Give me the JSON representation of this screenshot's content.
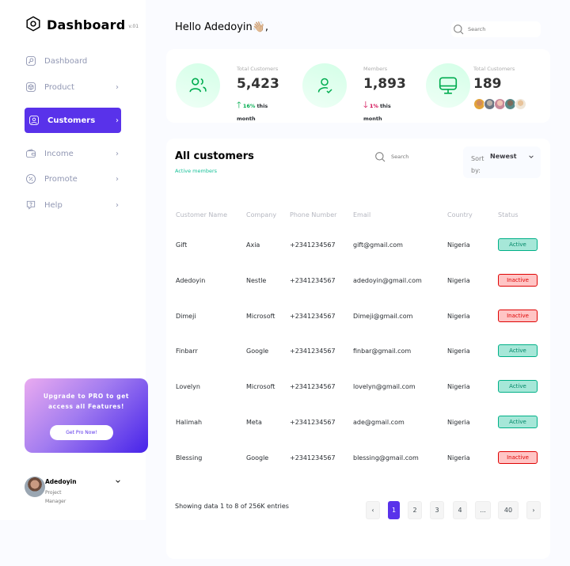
{
  "app": {
    "title": "Dashboard",
    "version": "v.01"
  },
  "sidebar": {
    "items": [
      {
        "label": "Dashboard",
        "icon": "key-square-icon",
        "has_chevron": false
      },
      {
        "label": "Product",
        "icon": "cube-icon",
        "has_chevron": true
      },
      {
        "label": "Customers",
        "icon": "user-square-icon",
        "has_chevron": true,
        "active": true
      },
      {
        "label": "Income",
        "icon": "wallet-money-icon",
        "has_chevron": true
      },
      {
        "label": "Promote",
        "icon": "discount-shape-icon",
        "has_chevron": true
      },
      {
        "label": "Help",
        "icon": "message-question-icon",
        "has_chevron": true
      }
    ],
    "chevron_glyph": "›"
  },
  "promo": {
    "text": "Upgrade to PRO to get access all Features!",
    "button_label": "Get Pro Now!"
  },
  "profile": {
    "name": "Adedoyin",
    "role": "Project Manager"
  },
  "header": {
    "greeting": "Hello Adedoyin👋🏼,",
    "search_placeholder": "Search"
  },
  "stats": [
    {
      "label": "Total Customers",
      "value": "5,423",
      "trend": "up",
      "percent": "16%",
      "period": "this month",
      "icon": "profile-2user-icon"
    },
    {
      "label": "Members",
      "value": "1,893",
      "trend": "down",
      "percent": "1%",
      "period": "this month",
      "icon": "profile-tick-icon"
    },
    {
      "label": "Total Customers",
      "value": "189",
      "icon": "monitor-icon",
      "avatars": 5
    }
  ],
  "table": {
    "title": "All customers",
    "subtitle": "Active members",
    "search_placeholder": "Search",
    "sort_label": "Sort by:",
    "sort_value": "Newest",
    "columns": [
      "Customer Name",
      "Company",
      "Phone Number",
      "Email",
      "Country",
      "Status"
    ],
    "rows": [
      {
        "name": "Gift",
        "company": "Axia",
        "phone": "+2341234567",
        "email": "gift@gmail.com",
        "country": "Nigeria",
        "status": "Active"
      },
      {
        "name": "Adedoyin",
        "company": "Nestle",
        "phone": "+2341234567",
        "email": "adedoyin@gmail.com",
        "country": "Nigeria",
        "status": "Inactive"
      },
      {
        "name": "Dimeji",
        "company": "Microsoft",
        "phone": "+2341234567",
        "email": "Dimeji@gmail.com",
        "country": "Nigeria",
        "status": "Inactive"
      },
      {
        "name": "Finbarr",
        "company": "Google",
        "phone": "+2341234567",
        "email": "finbar@gmail.com",
        "country": "Nigeria",
        "status": "Active"
      },
      {
        "name": "Lovelyn",
        "company": "Microsoft",
        "phone": "+2341234567",
        "email": "lovelyn@gmail.com",
        "country": "Nigeria",
        "status": "Active"
      },
      {
        "name": "Halimah",
        "company": "Meta",
        "phone": "+2341234567",
        "email": "ade@gmail.com",
        "country": "Nigeria",
        "status": "Active"
      },
      {
        "name": "Blessing",
        "company": "Google",
        "phone": "+2341234567",
        "email": "blessing@gmail.com",
        "country": "Nigeria",
        "status": "Inactive"
      }
    ],
    "showing": "Showing data 1 to 8 of 256K entries",
    "pagination": [
      "‹",
      "1",
      "2",
      "3",
      "4",
      "...",
      "40",
      "›"
    ],
    "current_page": "1"
  },
  "colors": {
    "accent": "#5932ea",
    "active_green": "#00b087",
    "inactive_red": "#df0404",
    "trend_up": "#00ac4f",
    "trend_down": "#d0004b"
  }
}
